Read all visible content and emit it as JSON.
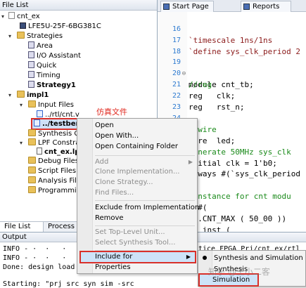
{
  "file_list": {
    "title": "File List",
    "tree": {
      "project": "cnt_ex",
      "device": "LFE5U-25F-6BG381C",
      "strategies": {
        "label": "Strategies",
        "items": [
          "Area",
          "I/O Assistant",
          "Quick",
          "Timing",
          "Strategy1"
        ]
      },
      "impl": {
        "label": "impl1",
        "input_files": {
          "label": "Input Files",
          "items": [
            "../rtl/cnt.v",
            "../testben"
          ]
        },
        "other_items": [
          "Synthesis Co",
          "LPF Constrai",
          "cnt_ex.lpf",
          "Debug Files",
          "Script Files",
          "Analysis File",
          "Programmin"
        ]
      }
    },
    "annotation": "仿真文件",
    "tabs": [
      "File List",
      "Process"
    ]
  },
  "editor": {
    "tabs": [
      "Start Page",
      "Reports"
    ],
    "lines": [
      {
        "n": "16",
        "t": "`timescale 1ns/1ns"
      },
      {
        "n": "17",
        "t": "`define sys_clk_period 2"
      },
      {
        "n": "18",
        "t": ""
      },
      {
        "n": "19",
        "t": "module cnt_tb;"
      },
      {
        "n": "20",
        "t": "//reg"
      },
      {
        "n": "21",
        "t": "reg   clk;"
      },
      {
        "n": "22",
        "t": "reg   rst_n;"
      },
      {
        "n": "23",
        "t": ""
      },
      {
        "n": "24",
        "t": "//wire"
      },
      {
        "n": "25",
        "t": "wire  led;"
      },
      {
        "n": "",
        "t": ""
      },
      {
        "n": "",
        "t": "generate 50MHz sys_clk"
      },
      {
        "n": "",
        "t": "initial clk = 1'b0;"
      },
      {
        "n": "",
        "t": "always #(`sys_clk_period"
      },
      {
        "n": "",
        "t": ""
      },
      {
        "n": "",
        "t": " instance for cnt modu"
      },
      {
        "n": "",
        "t": "t #("
      },
      {
        "n": "",
        "t": "  .CNT_MAX ( 50_00 ))"
      },
      {
        "n": "",
        "t": "nt_inst ("
      },
      {
        "n": "",
        "t": "  .clk"
      },
      {
        "n": "",
        "t": "  .rst_n"
      }
    ]
  },
  "context_menu": {
    "items": [
      {
        "label": "Open",
        "enabled": true
      },
      {
        "label": "Open With...",
        "enabled": true
      },
      {
        "label": "Open Containing Folder",
        "enabled": true
      },
      {
        "label": "Add",
        "enabled": false,
        "submenu": true
      },
      {
        "label": "Clone Implementation...",
        "enabled": false
      },
      {
        "label": "Clone Strategy...",
        "enabled": false
      },
      {
        "label": "Find Files...",
        "enabled": false
      },
      {
        "label": "Exclude from Implementation",
        "enabled": true
      },
      {
        "label": "Remove",
        "enabled": true
      },
      {
        "label": "Set Top-Level Unit...",
        "enabled": false
      },
      {
        "label": "Select Synthesis Tool...",
        "enabled": false
      },
      {
        "label": "Include for",
        "enabled": true,
        "submenu": true
      },
      {
        "label": "Properties",
        "enabled": true
      }
    ],
    "submenu": {
      "items": [
        "Synthesis and Simulation",
        "Synthesis",
        "Simulation"
      ]
    }
  },
  "output": {
    "title": "Output",
    "lines": [
      "INFO - ·  ·   ·      ·",
      "INFO - ·  ·   ·",
      "Done: design load",
      "",
      "Starting: \"prj src syn sim -src"
    ],
    "right_fragment": "tice FPGA Prj/cnt ex/rtl"
  },
  "watermark": "知乎 @王小二客",
  "colors": {
    "highlight_border": "#d9302a",
    "line_number": "#2d7ad0",
    "keyword": "#1f1fe0",
    "comment": "#1a8a1a"
  }
}
